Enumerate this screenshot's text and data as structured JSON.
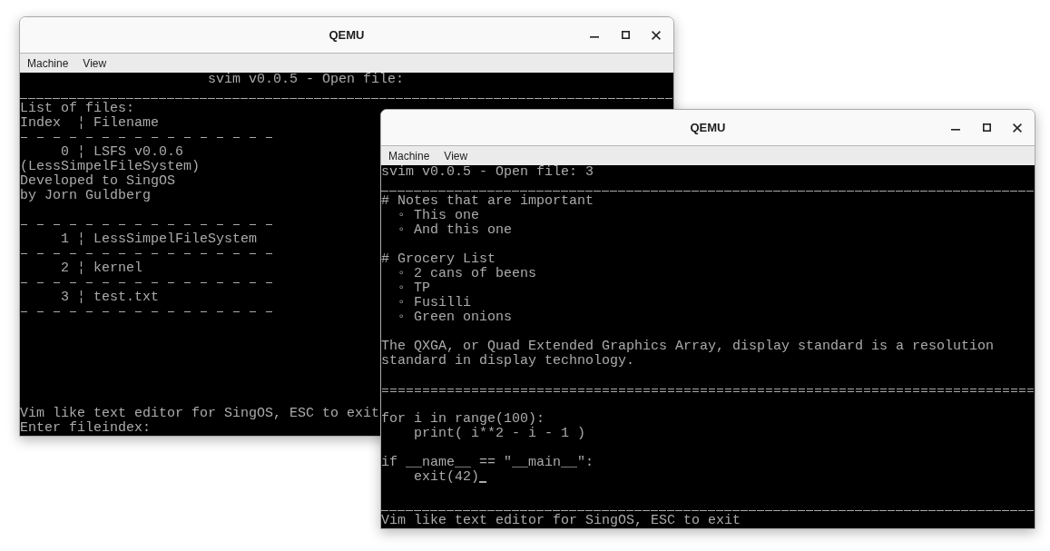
{
  "windows": [
    {
      "title": "QEMU",
      "menu": [
        "Machine",
        "View"
      ],
      "screen": {
        "body": [
          {
            "kind": "banner",
            "text": "svim v0.0.5 - Open file:"
          },
          {
            "kind": "underline"
          },
          {
            "kind": "text",
            "text": "List of files:"
          },
          {
            "kind": "head",
            "index": "Index",
            "separator": "¦",
            "name": "Filename"
          },
          {
            "kind": "dashes"
          },
          {
            "kind": "entry",
            "index": "0",
            "separator": "¦",
            "name": "LSFS v0.0.6"
          },
          {
            "kind": "text",
            "text": "(LessSimpelFileSystem)"
          },
          {
            "kind": "text",
            "text": "Developed to SingOS"
          },
          {
            "kind": "text",
            "text": "by Jorn Guldberg"
          },
          {
            "kind": "blank"
          },
          {
            "kind": "dashes"
          },
          {
            "kind": "entry",
            "index": "1",
            "separator": "¦",
            "name": "LessSimpelFileSystem"
          },
          {
            "kind": "dashes"
          },
          {
            "kind": "entry",
            "index": "2",
            "separator": "¦",
            "name": "kernel"
          },
          {
            "kind": "dashes"
          },
          {
            "kind": "entry",
            "index": "3",
            "separator": "¦",
            "name": "test.txt"
          },
          {
            "kind": "dashes"
          }
        ],
        "footer": [
          {
            "kind": "text",
            "text": "Vim like text editor for SingOS, ESC to exit"
          },
          {
            "kind": "text",
            "text": "Enter fileindex:"
          }
        ]
      }
    },
    {
      "title": "QEMU",
      "menu": [
        "Machine",
        "View"
      ],
      "screen": {
        "body": [
          {
            "kind": "text",
            "text": "svim v0.0.5 - Open file: 3"
          },
          {
            "kind": "underline"
          },
          {
            "kind": "text",
            "text": "# Notes that are important"
          },
          {
            "kind": "item",
            "bullet": "◦",
            "text": "This one"
          },
          {
            "kind": "item",
            "bullet": "◦",
            "text": "And this one"
          },
          {
            "kind": "blank"
          },
          {
            "kind": "text",
            "text": "# Grocery List"
          },
          {
            "kind": "item",
            "bullet": "◦",
            "text": "2 cans of beens"
          },
          {
            "kind": "item",
            "bullet": "◦",
            "text": "TP"
          },
          {
            "kind": "item",
            "bullet": "◦",
            "text": "Fusilli"
          },
          {
            "kind": "item",
            "bullet": "◦",
            "text": "Green onions"
          },
          {
            "kind": "blank"
          },
          {
            "kind": "paragraph",
            "text": "The QXGA, or Quad Extended Graphics Array, display standard is a resolution standard in display technology."
          },
          {
            "kind": "blank"
          },
          {
            "kind": "doubleline"
          },
          {
            "kind": "blank"
          },
          {
            "kind": "text",
            "text": "for i in range(100):"
          },
          {
            "kind": "indented",
            "text": "print( i**2 - i - 1 )"
          },
          {
            "kind": "blank"
          },
          {
            "kind": "text",
            "text": "if __name__ == \"__main__\":"
          },
          {
            "kind": "indented",
            "text": "exit(42)",
            "cursor": true
          }
        ],
        "footer": [
          {
            "kind": "underline"
          },
          {
            "kind": "text",
            "text": "Vim like text editor for SingOS, ESC to exit"
          }
        ]
      }
    }
  ]
}
